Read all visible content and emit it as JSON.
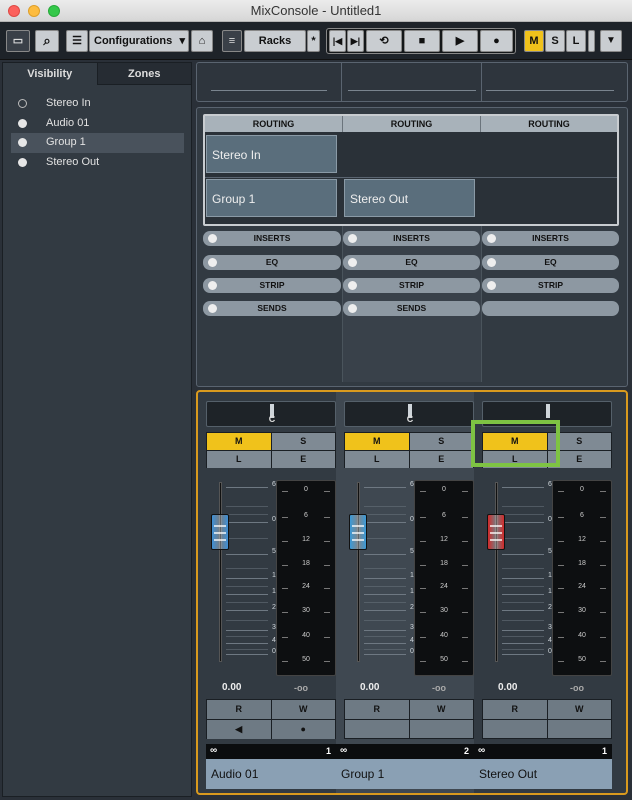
{
  "window": {
    "title": "MixConsole - Untitled1"
  },
  "toolbar": {
    "configurations": "Configurations",
    "racks": "Racks",
    "m": "M",
    "s": "S",
    "l": "L"
  },
  "left_panel": {
    "tabs": [
      "Visibility",
      "Zones"
    ],
    "items": [
      "Stereo In",
      "Audio 01",
      "Group 1",
      "Stereo Out"
    ]
  },
  "rack": {
    "routing_header": "ROUTING",
    "routing_cells": [
      "Stereo In",
      "Group 1",
      "Stereo Out"
    ],
    "sections": [
      "INSERTS",
      "EQ",
      "STRIP",
      "SENDS"
    ]
  },
  "channels": [
    {
      "name": "Audio 01",
      "number": "1",
      "pan": "C",
      "gain": "0.00",
      "peak": "-oo",
      "knob_color": "#3d8fd6",
      "fader_db": 0,
      "m_active": true
    },
    {
      "name": "Group 1",
      "number": "2",
      "pan": "C",
      "gain": "0.00",
      "peak": "-oo",
      "knob_color": "#3a9ad8",
      "fader_db": 0,
      "m_active": true
    },
    {
      "name": "Stereo Out",
      "number": "1",
      "pan": "",
      "gain": "0.00",
      "peak": "-oo",
      "knob_color": "#d22a2a",
      "fader_db": 0,
      "m_active": true
    }
  ],
  "buttons": {
    "m": "M",
    "s": "S",
    "l": "L",
    "e": "E",
    "r": "R",
    "w": "W"
  },
  "fader_scale": [
    "6",
    "0",
    "5",
    "10",
    "15",
    "20",
    "30",
    "40",
    "00"
  ],
  "meter_scale": [
    "0",
    "6",
    "12",
    "18",
    "24",
    "30",
    "40",
    "50"
  ],
  "colors": {
    "accent_yellow": "#f0c21b",
    "highlight_green": "#7ec343",
    "panel_orange": "#d99a1e"
  }
}
